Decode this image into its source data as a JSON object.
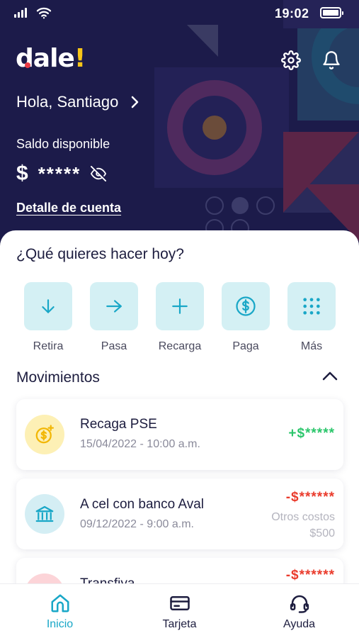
{
  "status_bar": {
    "time": "19:02"
  },
  "header": {
    "logo": {
      "main": "dale",
      "bang": "!"
    },
    "greeting": "Hola, Santiago",
    "balance_label": "Saldo disponible",
    "currency": "$",
    "balance_masked": "*****",
    "detail_link": "Detalle de cuenta"
  },
  "main": {
    "question": "¿Qué quieres hacer hoy?",
    "actions": [
      {
        "label": "Retira",
        "icon": "arrow-down-icon"
      },
      {
        "label": "Pasa",
        "icon": "arrow-right-icon"
      },
      {
        "label": "Recarga",
        "icon": "plus-icon"
      },
      {
        "label": "Paga",
        "icon": "dollar-coin-icon"
      },
      {
        "label": "Más",
        "icon": "grid-dots-icon"
      }
    ],
    "movements_title": "Movimientos",
    "movements": [
      {
        "title": "Recaga PSE",
        "date": "15/04/2022 - 10:00 a.m.",
        "amount": "+$*****",
        "type": "credit",
        "icon": "coin-plus-icon"
      },
      {
        "title": "A cel con banco Aval",
        "date": "09/12/2022 - 9:00 a.m.",
        "amount": "-$******",
        "type": "debit",
        "fee_label": "Otros costos",
        "fee_value": "$500",
        "icon": "bank-icon"
      },
      {
        "title": "Transfiya",
        "amount": "-$******",
        "type": "debit"
      }
    ]
  },
  "bottom_nav": [
    {
      "label": "Inicio",
      "icon": "home-icon",
      "active": true
    },
    {
      "label": "Tarjeta",
      "icon": "card-icon",
      "active": false
    },
    {
      "label": "Ayuda",
      "icon": "headset-icon",
      "active": false
    }
  ],
  "colors": {
    "header_bg": "#1c1b4a",
    "accent_teal": "#19a7c7",
    "action_bg": "#d4f0f4",
    "positive": "#2bc66b",
    "negative": "#ea3b2c",
    "logo_accent": "#f7c518"
  }
}
